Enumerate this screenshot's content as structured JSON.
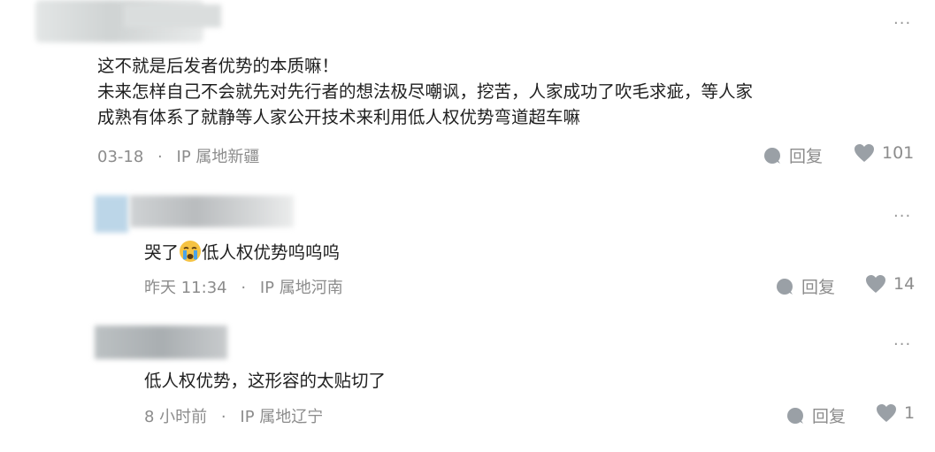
{
  "comments": [
    {
      "more": "···",
      "lines": [
        "这不就是后发者优势的本质嘛！",
        "未来怎样自己不会就先对先行者的想法极尽嘲讽，挖苦，人家成功了吹毛求疵，等人家",
        "成熟有体系了就静等人家公开技术来利用低人权优势弯道超车嘛"
      ],
      "time": "03-18",
      "ip": "IP 属地新疆",
      "reply": "回复",
      "likes": "101"
    },
    {
      "more": "···",
      "text_before": "哭了",
      "emoji": "crying-face-icon",
      "text_after": "低人权优势呜呜呜",
      "time": "昨天 11:34",
      "ip": "IP 属地河南",
      "reply": "回复",
      "likes": "14"
    },
    {
      "more": "···",
      "text": "低人权优势，这形容的太贴切了",
      "time": "8 小时前",
      "ip": "IP 属地辽宁",
      "reply": "回复",
      "likes": "1"
    }
  ],
  "meta_separator": "·",
  "colors": {
    "meta": "#8c8c8c",
    "text": "#1f1f1f",
    "icon": "#9aa0a6"
  }
}
